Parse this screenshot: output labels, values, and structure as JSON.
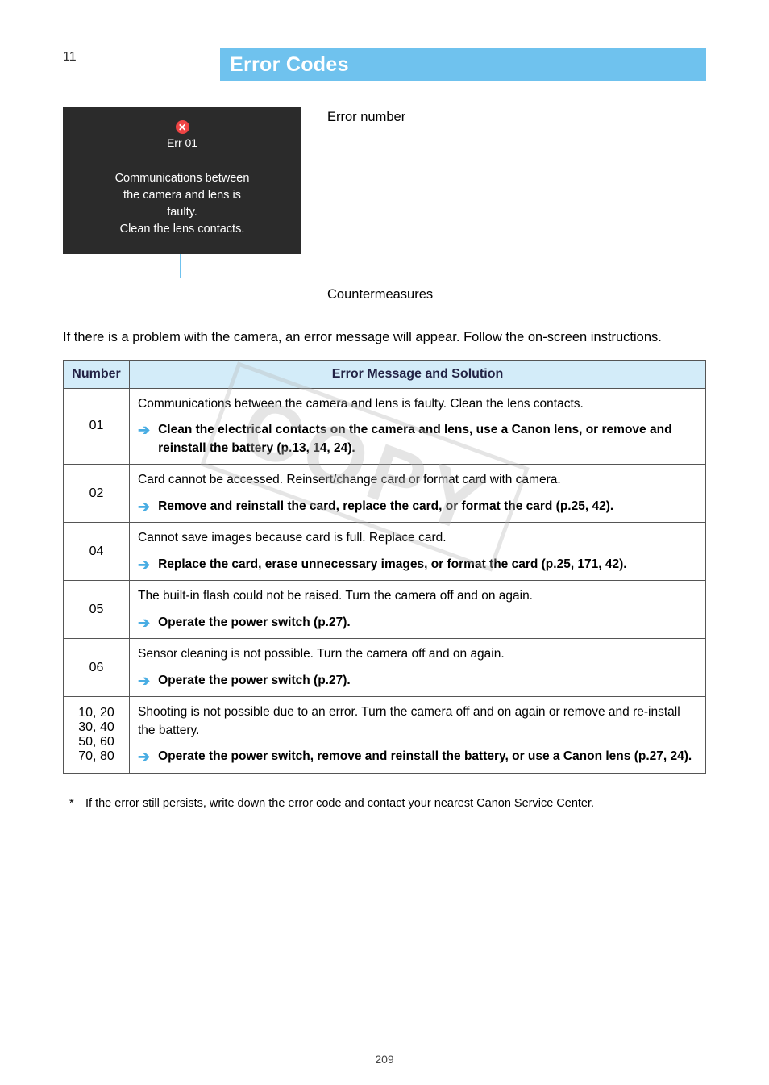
{
  "header": {
    "page_num_top": "11",
    "title": "Error Codes"
  },
  "diagram": {
    "err_number_label": "Error number",
    "cam_err_code": "Err 01",
    "cam_message_l1": "Communications between",
    "cam_message_l2": "the camera and lens is",
    "cam_message_l3": "faulty.",
    "cam_message_l4": "Clean the lens contacts.",
    "countermeasure_label": "Countermeasures",
    "intro": "If there is a problem with the camera, an error message will appear. Follow the on-screen instructions."
  },
  "table": {
    "col_number": "Number",
    "col_message": "Error Message and Solution",
    "rows": [
      {
        "num": "01",
        "msg": "Communications between the camera and lens is faulty. Clean the lens contacts.",
        "action": "Clean the electrical contacts on the camera and lens, use a Canon lens, or remove and reinstall the battery (p.13, 14, 24)."
      },
      {
        "num": "02",
        "msg": "Card cannot be accessed. Reinsert/change card or format card with camera.",
        "action": "Remove and reinstall the card, replace the card, or format the card (p.25, 42)."
      },
      {
        "num": "04",
        "msg": "Cannot save images because card is full. Replace card.",
        "action": "Replace the card, erase unnecessary images, or format the card (p.25, 171, 42)."
      },
      {
        "num": "05",
        "msg": "The built-in flash could not be raised. Turn the camera off and on again.",
        "action": "Operate the power switch (p.27)."
      },
      {
        "num": "06",
        "msg": "Sensor cleaning is not possible. Turn the camera off and on again.",
        "action": "Operate the power switch (p.27)."
      }
    ],
    "extra_rows": [
      {
        "nums": "10, 20\n30, 40\n50, 60\n70, 80",
        "msg": "Shooting is not possible due to an error. Turn the camera off and on again or remove and re-install the battery.",
        "action": "Operate the power switch, remove and reinstall the battery, or use a Canon lens (p.27, 24)."
      }
    ]
  },
  "footnote": "If the error still persists, write down the error code and contact your nearest Canon Service Center.",
  "watermark": "COPY",
  "foot_page": "209",
  "chart_data": {
    "type": "table",
    "title": "Camera Error Codes",
    "columns": [
      "Number",
      "Error Message",
      "Solution"
    ],
    "rows": [
      [
        "01",
        "Communications between the camera and lens is faulty. Clean the lens contacts.",
        "Clean the electrical contacts on the camera and lens, use a Canon lens, or remove and reinstall the battery (p.13, 14, 24)."
      ],
      [
        "02",
        "Card cannot be accessed. Reinsert/change card or format card with camera.",
        "Remove and reinstall the card, replace the card, or format the card (p.25, 42)."
      ],
      [
        "04",
        "Cannot save images because card is full. Replace card.",
        "Replace the card, erase unnecessary images, or format the card (p.25, 171, 42)."
      ],
      [
        "05",
        "The built-in flash could not be raised. Turn the camera off and on again.",
        "Operate the power switch (p.27)."
      ],
      [
        "06",
        "Sensor cleaning is not possible. Turn the camera off and on again.",
        "Operate the power switch (p.27)."
      ],
      [
        "10,20,30,40,50,60,70,80",
        "Shooting is not possible due to an error. Turn the camera off and on again or remove and re-install the battery.",
        "Operate the power switch, remove and reinstall the battery, or use a Canon lens (p.27, 24)."
      ]
    ]
  }
}
